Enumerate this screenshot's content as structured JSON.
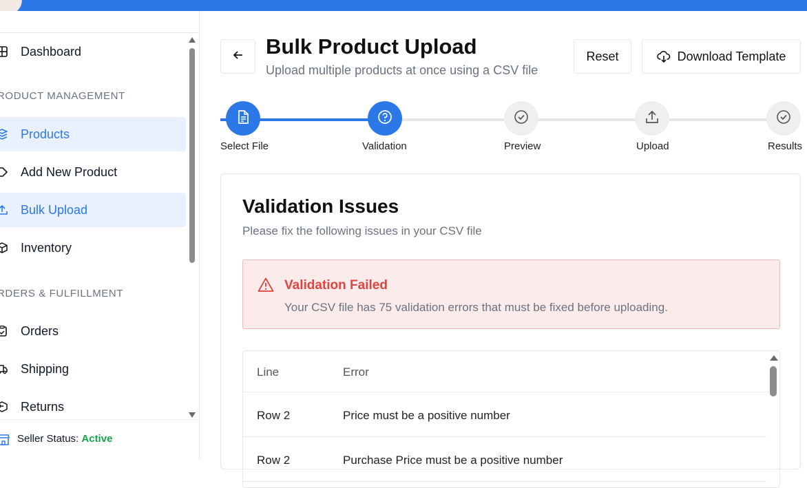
{
  "sidebar": {
    "items": [
      {
        "label": "Dashboard",
        "icon": "grid-icon"
      },
      {
        "label": "Products",
        "icon": "layers-icon"
      },
      {
        "label": "Add New Product",
        "icon": "tag-icon"
      },
      {
        "label": "Bulk Upload",
        "icon": "upload-icon"
      },
      {
        "label": "Inventory",
        "icon": "box-icon"
      },
      {
        "label": "Orders",
        "icon": "clipboard-icon"
      },
      {
        "label": "Shipping",
        "icon": "truck-icon"
      },
      {
        "label": "Returns",
        "icon": "return-icon"
      }
    ],
    "sections": {
      "product_management": "RODUCT MANAGEMENT",
      "orders_fulfillment": "RDERS & FULFILLMENT"
    },
    "seller_status": {
      "label": "Seller Status:",
      "value": "Active"
    }
  },
  "header": {
    "title": "Bulk Product Upload",
    "subtitle": "Upload multiple products at once using a CSV file",
    "reset_label": "Reset",
    "download_label": "Download Template"
  },
  "stepper": {
    "steps": [
      {
        "label": "Select File",
        "status": "complete"
      },
      {
        "label": "Validation",
        "status": "current"
      },
      {
        "label": "Preview",
        "status": "pending"
      },
      {
        "label": "Upload",
        "status": "pending"
      },
      {
        "label": "Results",
        "status": "pending"
      }
    ]
  },
  "validation": {
    "title": "Validation Issues",
    "subtitle": "Please fix the following issues in your CSV file",
    "alert": {
      "title": "Validation Failed",
      "message": "Your CSV file has 75 validation errors that must be fixed before uploading."
    },
    "table": {
      "columns": [
        "Line",
        "Error"
      ],
      "rows": [
        {
          "line": "Row 2",
          "error": "Price must be a positive number"
        },
        {
          "line": "Row 2",
          "error": "Purchase Price must be a positive number"
        }
      ]
    }
  },
  "colors": {
    "accent": "#2b78e9",
    "error": "#e0443e",
    "success": "#16a34a"
  }
}
